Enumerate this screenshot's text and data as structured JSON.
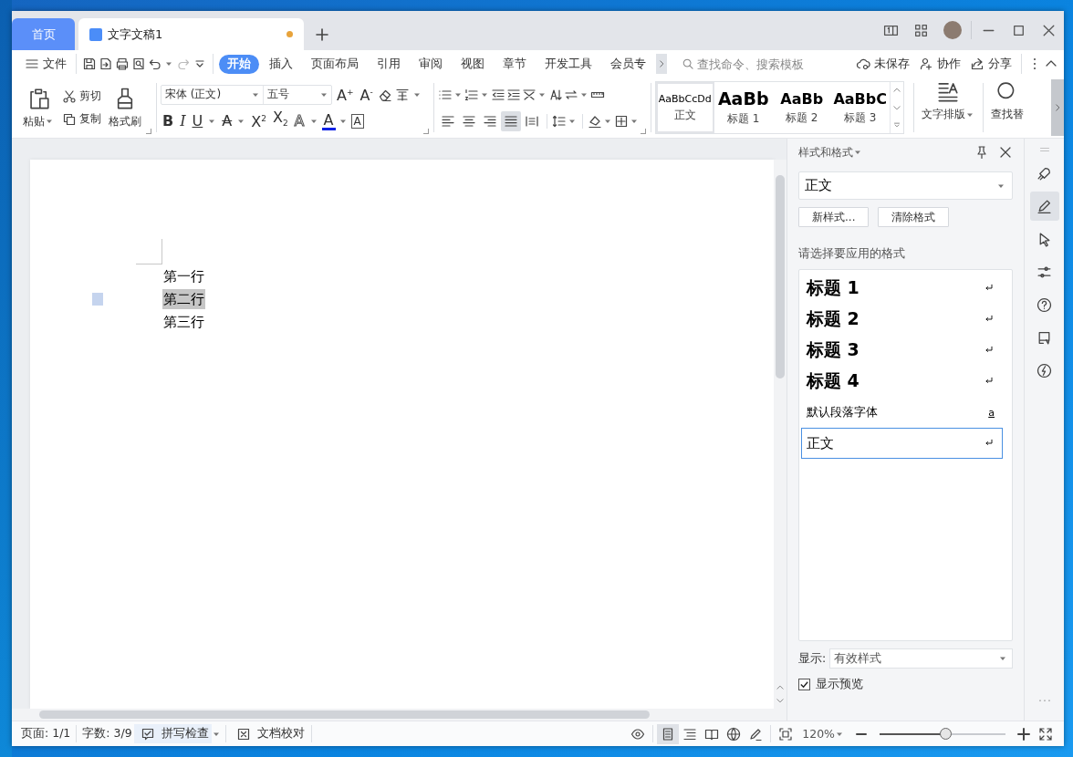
{
  "tabs": [
    {
      "label": "首页",
      "kind": "home",
      "selected": false,
      "unsaved": false
    },
    {
      "label": "文字文稿1",
      "kind": "doc",
      "selected": true,
      "unsaved": true
    }
  ],
  "menu": {
    "file": "文件",
    "tabs": [
      {
        "label": "开始",
        "selected": true
      },
      {
        "label": "插入",
        "selected": false
      },
      {
        "label": "页面布局",
        "selected": false
      },
      {
        "label": "引用",
        "selected": false
      },
      {
        "label": "审阅",
        "selected": false
      },
      {
        "label": "视图",
        "selected": false
      },
      {
        "label": "章节",
        "selected": false
      },
      {
        "label": "开发工具",
        "selected": false
      },
      {
        "label": "会员专",
        "selected": false
      }
    ],
    "search": {
      "placeholder": "查找命令、搜索模板"
    },
    "actions": [
      {
        "kind": "cloud",
        "label": "未保存"
      },
      {
        "kind": "collab",
        "label": "协作"
      },
      {
        "kind": "share",
        "label": "分享"
      }
    ]
  },
  "ribbon": {
    "paste": "粘贴",
    "cut": "剪切",
    "copy": "复制",
    "format_painter": "格式刷",
    "font": {
      "family": "宋体 (正文)",
      "size": "五号",
      "grow": "A$^{+}$",
      "shrink": "A$^{-}$"
    },
    "format_buttons": [
      {
        "label": "B",
        "kind": "bold",
        "dropdown": false
      },
      {
        "label": "I",
        "kind": "italic",
        "dropdown": false
      },
      {
        "label": "U",
        "kind": "underline",
        "dropdown": true
      },
      {
        "label": "A",
        "kind": "strike",
        "dropdown": true
      },
      {
        "label": "X$^{2}$",
        "kind": "plain",
        "dropdown": false
      },
      {
        "label": "X$_{2}$",
        "kind": "plain",
        "dropdown": false
      },
      {
        "label": "A",
        "kind": "outline",
        "dropdown": true
      },
      {
        "label": "A",
        "kind": "color",
        "dropdown": true
      },
      {
        "label": "A",
        "kind": "boxed",
        "dropdown": false
      }
    ],
    "alignment": [
      {
        "kind": "left",
        "selected": false
      },
      {
        "kind": "center",
        "selected": false
      },
      {
        "kind": "right",
        "selected": false
      },
      {
        "kind": "justify",
        "selected": true
      },
      {
        "kind": "distributed",
        "selected": false
      }
    ],
    "gallery": [
      {
        "preview": "AaBbCcDd",
        "label": "正文",
        "kind": "body",
        "selected": true
      },
      {
        "preview": "AaBb",
        "label": "标题 1",
        "kind": "h1",
        "selected": false
      },
      {
        "preview": "AaBb",
        "label": "标题 2",
        "kind": "h2",
        "selected": false
      },
      {
        "preview": "AaBbC",
        "label": "标题 3",
        "kind": "h3",
        "selected": false
      }
    ],
    "text_layout": "文字排版",
    "find": "查找替"
  },
  "document": {
    "lines": [
      {
        "text": "第一行",
        "selected": false
      },
      {
        "text": "第二行",
        "selected": true
      },
      {
        "text": "第三行",
        "selected": false
      }
    ]
  },
  "panel": {
    "title": "样式和格式",
    "current": "正文",
    "buttons": [
      "新样式...",
      "清除格式"
    ],
    "prompt": "请选择要应用的格式",
    "styles": [
      {
        "name": "标题 1",
        "kind": "h1",
        "selected": false
      },
      {
        "name": "标题 2",
        "kind": "h2",
        "selected": false
      },
      {
        "name": "标题 3",
        "kind": "h3",
        "selected": false
      },
      {
        "name": "标题 4",
        "kind": "h4",
        "selected": false
      },
      {
        "name": "默认段落字体",
        "kind": "character",
        "marker": "a",
        "selected": false
      },
      {
        "name": "正文",
        "kind": "body",
        "selected": true
      }
    ],
    "show_label": "显示:",
    "show_value": "有效样式",
    "preview": {
      "label": "显示预览",
      "checked": true
    }
  },
  "side_tools": [
    {
      "kind": "rocket",
      "selected": false
    },
    {
      "kind": "pen",
      "selected": true
    },
    {
      "kind": "cursor",
      "selected": false
    },
    {
      "kind": "sliders",
      "selected": false
    },
    {
      "kind": "help",
      "selected": false
    },
    {
      "kind": "image",
      "selected": false
    },
    {
      "kind": "bolt",
      "selected": false
    }
  ],
  "status": {
    "page": "页面: 1/1",
    "words": "字数: 3/9",
    "spell": "拼写检查",
    "proof": "文档校对",
    "views": [
      {
        "kind": "page",
        "selected": true
      },
      {
        "kind": "outline",
        "selected": false
      },
      {
        "kind": "read",
        "selected": false
      },
      {
        "kind": "web",
        "selected": false
      },
      {
        "kind": "write",
        "selected": false
      }
    ],
    "zoom": "120%",
    "zoom_slider": {
      "level": 0.52
    }
  }
}
